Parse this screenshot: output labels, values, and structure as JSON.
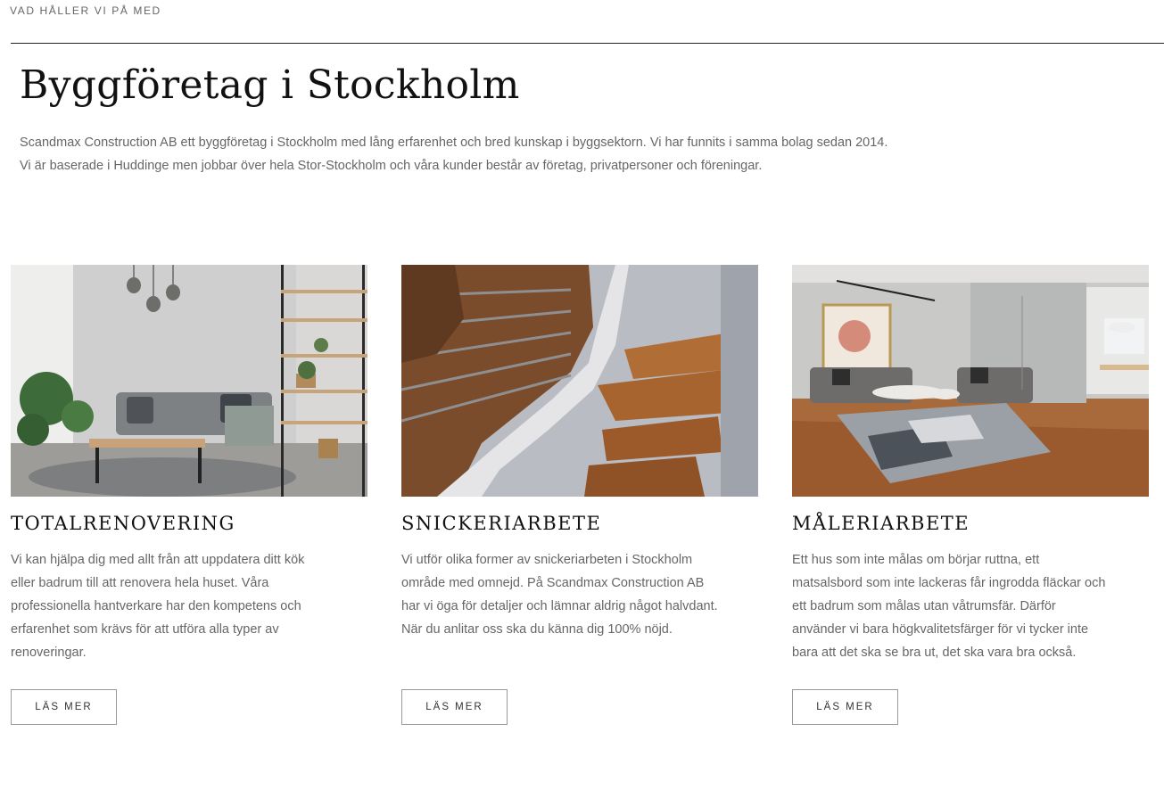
{
  "section": {
    "eyebrow": "VAD HÅLLER VI PÅ MED",
    "title": "Byggföretag i Stockholm",
    "intro": [
      "Scandmax Construction AB ett byggföretag i Stockholm med lång erfarenhet och bred kunskap i byggsektorn. Vi har funnits i samma bolag sedan 2014.",
      "Vi är baserade i Huddinge men jobbar över hela Stor-Stockholm och våra kunder består av företag, privatpersoner och föreningar."
    ]
  },
  "services": [
    {
      "image": "living-room-photo",
      "title": "TOTALRENOVERING",
      "text": "Vi kan hjälpa dig med allt från att uppdatera ditt kök eller badrum till att renovera hela huset. Våra professionella hantverkare har den kompetens och erfarenhet som krävs för att utföra alla typer av renoveringar.",
      "button": "LÄS MER"
    },
    {
      "image": "wooden-staircase-photo",
      "title": "SNICKERIARBETE",
      "text": "Vi utför olika former av snickeriarbeten i Stockholm område med omnejd. På Scandmax Construction AB har vi öga för detaljer och lämnar aldrig något halvdant. När du anlitar oss ska du känna dig 100% nöjd.",
      "button": "LÄS MER"
    },
    {
      "image": "interior-room-photo",
      "title": "MÅLERIARBETE",
      "text": "Ett hus som inte målas om börjar ruttna, ett matsalsbord som inte lackeras får ingrodda fläckar och ett badrum som målas utan våtrumsfär. Därför använder vi bara högkvalitetsfärger för vi tycker inte bara att det ska se bra ut, det ska vara bra också.",
      "button": "LÄS MER"
    }
  ]
}
